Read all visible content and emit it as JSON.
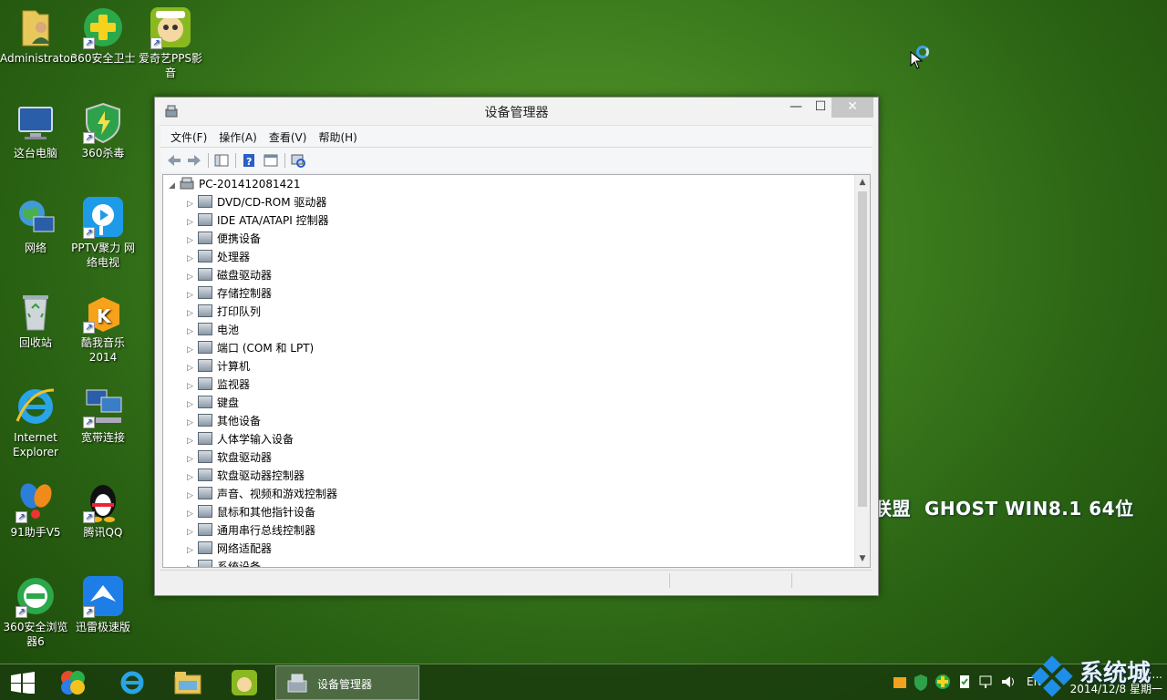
{
  "desktop": {
    "icons": [
      {
        "label": "Administrator",
        "icon": "user-folder-icon"
      },
      {
        "label": "360安全卫士",
        "icon": "360-security-icon"
      },
      {
        "label": "爱奇艺PPS影音",
        "icon": "iqiyi-pps-icon"
      },
      {
        "label": "这台电脑",
        "icon": "computer-icon"
      },
      {
        "label": "360杀毒",
        "icon": "360-antivirus-icon"
      },
      {
        "label": "网络",
        "icon": "network-globe-icon"
      },
      {
        "label": "PPTV聚力 网络电视",
        "icon": "pptv-icon"
      },
      {
        "label": "回收站",
        "icon": "recycle-bin-icon"
      },
      {
        "label": "酷我音乐2014",
        "icon": "kuwo-music-icon"
      },
      {
        "label": "Internet Explorer",
        "icon": "ie-icon"
      },
      {
        "label": "宽带连接",
        "icon": "broadband-icon"
      },
      {
        "label": "91助手V5",
        "icon": "91-assistant-icon"
      },
      {
        "label": "腾讯QQ",
        "icon": "qq-penguin-icon"
      },
      {
        "label": "360安全浏览器6",
        "icon": "360-browser-icon"
      },
      {
        "label": "迅雷极速版",
        "icon": "xunlei-icon"
      }
    ],
    "ghost_text": "GHOST WIN8.1 64位",
    "ghost_prefix": "联盟"
  },
  "window": {
    "title": "设备管理器",
    "menu": [
      "文件(F)",
      "操作(A)",
      "查看(V)",
      "帮助(H)"
    ],
    "root": "PC-201412081421",
    "devices": [
      {
        "label": "DVD/CD-ROM 驱动器",
        "icon": "dvd-drive-icon"
      },
      {
        "label": "IDE ATA/ATAPI 控制器",
        "icon": "ide-controller-icon"
      },
      {
        "label": "便携设备",
        "icon": "portable-device-icon"
      },
      {
        "label": "处理器",
        "icon": "processor-icon"
      },
      {
        "label": "磁盘驱动器",
        "icon": "disk-drive-icon"
      },
      {
        "label": "存储控制器",
        "icon": "storage-controller-icon"
      },
      {
        "label": "打印队列",
        "icon": "printer-icon"
      },
      {
        "label": "电池",
        "icon": "battery-icon"
      },
      {
        "label": "端口 (COM 和 LPT)",
        "icon": "port-icon"
      },
      {
        "label": "计算机",
        "icon": "computer-icon"
      },
      {
        "label": "监视器",
        "icon": "monitor-icon"
      },
      {
        "label": "键盘",
        "icon": "keyboard-icon"
      },
      {
        "label": "其他设备",
        "icon": "other-device-icon"
      },
      {
        "label": "人体学输入设备",
        "icon": "hid-icon"
      },
      {
        "label": "软盘驱动器",
        "icon": "floppy-drive-icon"
      },
      {
        "label": "软盘驱动器控制器",
        "icon": "floppy-controller-icon"
      },
      {
        "label": "声音、视频和游戏控制器",
        "icon": "sound-icon"
      },
      {
        "label": "鼠标和其他指针设备",
        "icon": "mouse-icon"
      },
      {
        "label": "通用串行总线控制器",
        "icon": "usb-icon"
      },
      {
        "label": "网络适配器",
        "icon": "network-adapter-icon"
      },
      {
        "label": "系统设备",
        "icon": "system-device-icon"
      }
    ]
  },
  "taskbar": {
    "active_window": "设备管理器",
    "lang": "EN",
    "time": "22:...",
    "date": "2014/12/8 星期一"
  },
  "watermark": {
    "text": "系统城"
  }
}
